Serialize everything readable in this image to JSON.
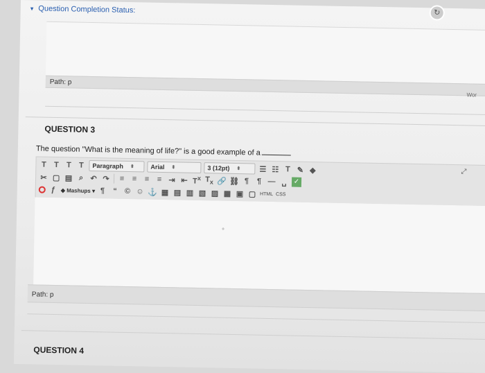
{
  "status": {
    "chevron": "▾",
    "label": "Question Completion Status:"
  },
  "editor1": {
    "path": "Path: p",
    "word_count_label": "Wor"
  },
  "question3": {
    "title": "QUESTION 3",
    "text": "The question \"What is the meaning of life?\" is a good example of a",
    "toolbar": {
      "row1": {
        "format_buttons": [
          "T",
          "T",
          "T",
          "T"
        ],
        "paragraph": "Paragraph",
        "font": "Arial",
        "size": "3 (12pt)"
      },
      "row2": {
        "superscript_label": "T",
        "subscript_label": "T"
      },
      "row3": {
        "mashups": "Mashups",
        "html": "HTML",
        "css": "CSS"
      }
    },
    "path": "Path: p"
  },
  "question4": {
    "title": "QUESTION 4"
  },
  "colors": {
    "link": "#2a5fb0",
    "accent_red": "#d33"
  }
}
